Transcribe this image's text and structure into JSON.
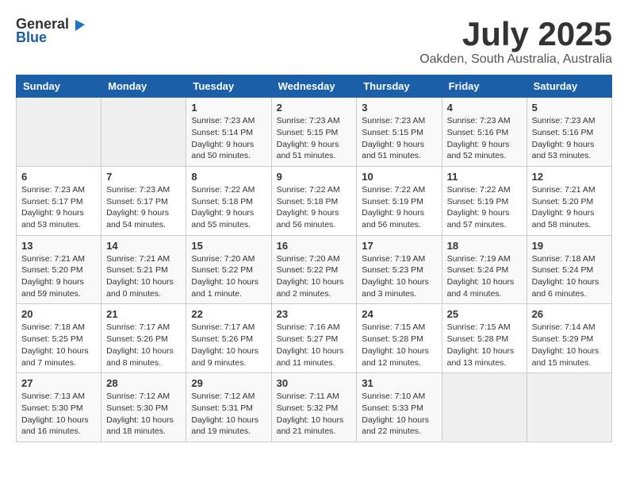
{
  "header": {
    "logo_general": "General",
    "logo_blue": "Blue",
    "month_title": "July 2025",
    "location": "Oakden, South Australia, Australia"
  },
  "weekdays": [
    "Sunday",
    "Monday",
    "Tuesday",
    "Wednesday",
    "Thursday",
    "Friday",
    "Saturday"
  ],
  "weeks": [
    [
      {
        "day": "",
        "sunrise": "",
        "sunset": "",
        "daylight": ""
      },
      {
        "day": "",
        "sunrise": "",
        "sunset": "",
        "daylight": ""
      },
      {
        "day": "1",
        "sunrise": "Sunrise: 7:23 AM",
        "sunset": "Sunset: 5:14 PM",
        "daylight": "Daylight: 9 hours and 50 minutes."
      },
      {
        "day": "2",
        "sunrise": "Sunrise: 7:23 AM",
        "sunset": "Sunset: 5:15 PM",
        "daylight": "Daylight: 9 hours and 51 minutes."
      },
      {
        "day": "3",
        "sunrise": "Sunrise: 7:23 AM",
        "sunset": "Sunset: 5:15 PM",
        "daylight": "Daylight: 9 hours and 51 minutes."
      },
      {
        "day": "4",
        "sunrise": "Sunrise: 7:23 AM",
        "sunset": "Sunset: 5:16 PM",
        "daylight": "Daylight: 9 hours and 52 minutes."
      },
      {
        "day": "5",
        "sunrise": "Sunrise: 7:23 AM",
        "sunset": "Sunset: 5:16 PM",
        "daylight": "Daylight: 9 hours and 53 minutes."
      }
    ],
    [
      {
        "day": "6",
        "sunrise": "Sunrise: 7:23 AM",
        "sunset": "Sunset: 5:17 PM",
        "daylight": "Daylight: 9 hours and 53 minutes."
      },
      {
        "day": "7",
        "sunrise": "Sunrise: 7:23 AM",
        "sunset": "Sunset: 5:17 PM",
        "daylight": "Daylight: 9 hours and 54 minutes."
      },
      {
        "day": "8",
        "sunrise": "Sunrise: 7:22 AM",
        "sunset": "Sunset: 5:18 PM",
        "daylight": "Daylight: 9 hours and 55 minutes."
      },
      {
        "day": "9",
        "sunrise": "Sunrise: 7:22 AM",
        "sunset": "Sunset: 5:18 PM",
        "daylight": "Daylight: 9 hours and 56 minutes."
      },
      {
        "day": "10",
        "sunrise": "Sunrise: 7:22 AM",
        "sunset": "Sunset: 5:19 PM",
        "daylight": "Daylight: 9 hours and 56 minutes."
      },
      {
        "day": "11",
        "sunrise": "Sunrise: 7:22 AM",
        "sunset": "Sunset: 5:19 PM",
        "daylight": "Daylight: 9 hours and 57 minutes."
      },
      {
        "day": "12",
        "sunrise": "Sunrise: 7:21 AM",
        "sunset": "Sunset: 5:20 PM",
        "daylight": "Daylight: 9 hours and 58 minutes."
      }
    ],
    [
      {
        "day": "13",
        "sunrise": "Sunrise: 7:21 AM",
        "sunset": "Sunset: 5:20 PM",
        "daylight": "Daylight: 9 hours and 59 minutes."
      },
      {
        "day": "14",
        "sunrise": "Sunrise: 7:21 AM",
        "sunset": "Sunset: 5:21 PM",
        "daylight": "Daylight: 10 hours and 0 minutes."
      },
      {
        "day": "15",
        "sunrise": "Sunrise: 7:20 AM",
        "sunset": "Sunset: 5:22 PM",
        "daylight": "Daylight: 10 hours and 1 minute."
      },
      {
        "day": "16",
        "sunrise": "Sunrise: 7:20 AM",
        "sunset": "Sunset: 5:22 PM",
        "daylight": "Daylight: 10 hours and 2 minutes."
      },
      {
        "day": "17",
        "sunrise": "Sunrise: 7:19 AM",
        "sunset": "Sunset: 5:23 PM",
        "daylight": "Daylight: 10 hours and 3 minutes."
      },
      {
        "day": "18",
        "sunrise": "Sunrise: 7:19 AM",
        "sunset": "Sunset: 5:24 PM",
        "daylight": "Daylight: 10 hours and 4 minutes."
      },
      {
        "day": "19",
        "sunrise": "Sunrise: 7:18 AM",
        "sunset": "Sunset: 5:24 PM",
        "daylight": "Daylight: 10 hours and 6 minutes."
      }
    ],
    [
      {
        "day": "20",
        "sunrise": "Sunrise: 7:18 AM",
        "sunset": "Sunset: 5:25 PM",
        "daylight": "Daylight: 10 hours and 7 minutes."
      },
      {
        "day": "21",
        "sunrise": "Sunrise: 7:17 AM",
        "sunset": "Sunset: 5:26 PM",
        "daylight": "Daylight: 10 hours and 8 minutes."
      },
      {
        "day": "22",
        "sunrise": "Sunrise: 7:17 AM",
        "sunset": "Sunset: 5:26 PM",
        "daylight": "Daylight: 10 hours and 9 minutes."
      },
      {
        "day": "23",
        "sunrise": "Sunrise: 7:16 AM",
        "sunset": "Sunset: 5:27 PM",
        "daylight": "Daylight: 10 hours and 11 minutes."
      },
      {
        "day": "24",
        "sunrise": "Sunrise: 7:15 AM",
        "sunset": "Sunset: 5:28 PM",
        "daylight": "Daylight: 10 hours and 12 minutes."
      },
      {
        "day": "25",
        "sunrise": "Sunrise: 7:15 AM",
        "sunset": "Sunset: 5:28 PM",
        "daylight": "Daylight: 10 hours and 13 minutes."
      },
      {
        "day": "26",
        "sunrise": "Sunrise: 7:14 AM",
        "sunset": "Sunset: 5:29 PM",
        "daylight": "Daylight: 10 hours and 15 minutes."
      }
    ],
    [
      {
        "day": "27",
        "sunrise": "Sunrise: 7:13 AM",
        "sunset": "Sunset: 5:30 PM",
        "daylight": "Daylight: 10 hours and 16 minutes."
      },
      {
        "day": "28",
        "sunrise": "Sunrise: 7:12 AM",
        "sunset": "Sunset: 5:30 PM",
        "daylight": "Daylight: 10 hours and 18 minutes."
      },
      {
        "day": "29",
        "sunrise": "Sunrise: 7:12 AM",
        "sunset": "Sunset: 5:31 PM",
        "daylight": "Daylight: 10 hours and 19 minutes."
      },
      {
        "day": "30",
        "sunrise": "Sunrise: 7:11 AM",
        "sunset": "Sunset: 5:32 PM",
        "daylight": "Daylight: 10 hours and 21 minutes."
      },
      {
        "day": "31",
        "sunrise": "Sunrise: 7:10 AM",
        "sunset": "Sunset: 5:33 PM",
        "daylight": "Daylight: 10 hours and 22 minutes."
      },
      {
        "day": "",
        "sunrise": "",
        "sunset": "",
        "daylight": ""
      },
      {
        "day": "",
        "sunrise": "",
        "sunset": "",
        "daylight": ""
      }
    ]
  ]
}
